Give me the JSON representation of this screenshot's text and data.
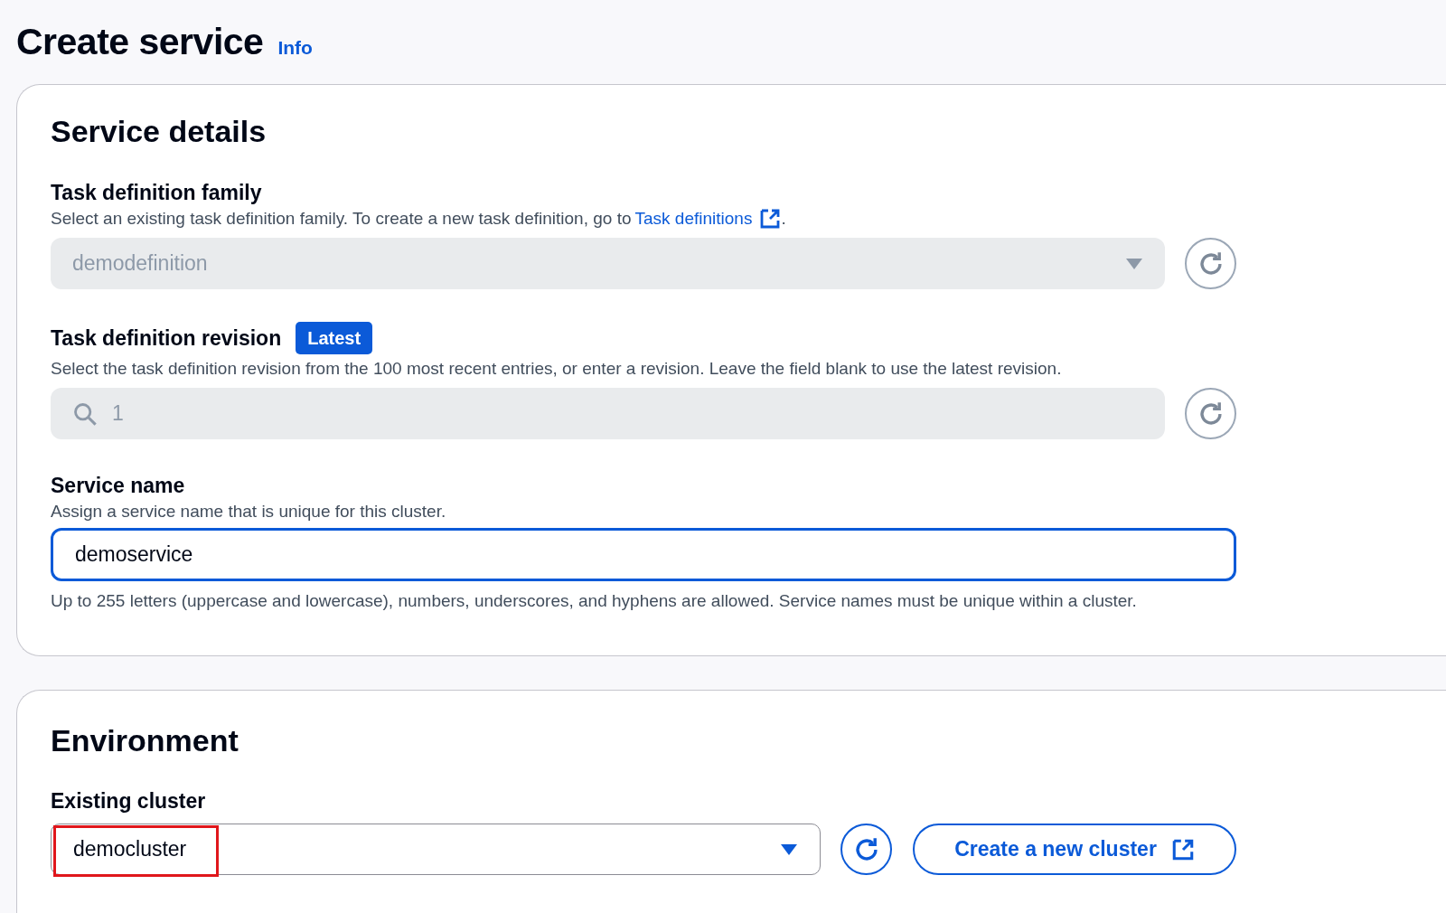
{
  "page": {
    "title": "Create service",
    "info_link": "Info"
  },
  "service_details": {
    "heading": "Service details",
    "task_definition_family": {
      "label": "Task definition family",
      "description_before": "Select an existing task definition family. To create a new task definition, go to ",
      "link": "Task definitions",
      "description_after": ".",
      "value": "demodefinition",
      "disabled": true
    },
    "task_definition_revision": {
      "label": "Task definition revision",
      "badge": "Latest",
      "description": "Select the task definition revision from the 100 most recent entries, or enter a revision. Leave the field blank to use the latest revision.",
      "value": "1",
      "disabled": true
    },
    "service_name": {
      "label": "Service name",
      "description": "Assign a service name that is unique for this cluster.",
      "value": "demoservice",
      "focused": true,
      "constraint": "Up to 255 letters (uppercase and lowercase), numbers, underscores, and hyphens are allowed. Service names must be unique within a cluster."
    }
  },
  "environment": {
    "heading": "Environment",
    "existing_cluster": {
      "label": "Existing cluster",
      "value": "democluster",
      "highlighted": true
    },
    "create_button": "Create a new cluster"
  }
}
